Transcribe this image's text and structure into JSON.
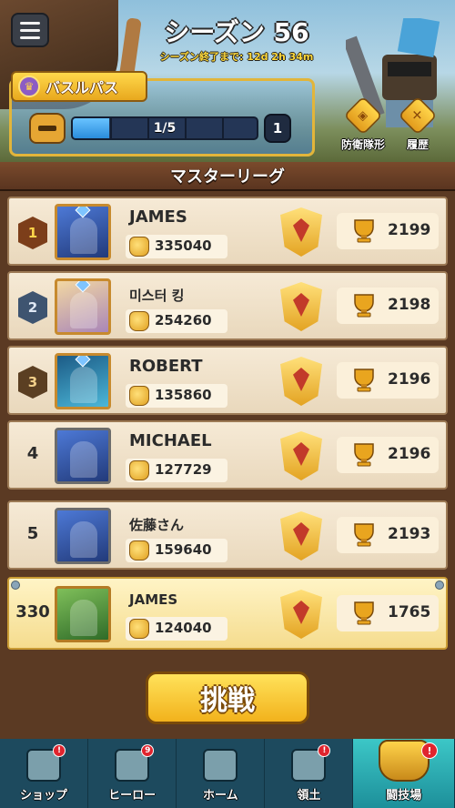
{
  "header": {
    "season_title": "シーズン 56",
    "season_remaining": "シーズン終了まで: 12d 2h 34m"
  },
  "pass": {
    "label": "バスルパス",
    "progress_text": "1/5",
    "progress_fraction": 0.2,
    "level": "1"
  },
  "side_buttons": [
    {
      "label": "防衛隊形",
      "icon": "formation-icon"
    },
    {
      "label": "履歴",
      "icon": "history-icon"
    }
  ],
  "league": {
    "title": "マスターリーグ"
  },
  "rows": [
    {
      "rank": "1",
      "name": "JAMES",
      "score": "335040",
      "trophies": "2199"
    },
    {
      "rank": "2",
      "name": "미스터 킹",
      "score": "254260",
      "trophies": "2198"
    },
    {
      "rank": "3",
      "name": "ROBERT",
      "score": "135860",
      "trophies": "2196"
    },
    {
      "rank": "4",
      "name": "MICHAEL",
      "score": "127729",
      "trophies": "2196"
    },
    {
      "rank": "5",
      "name": "佐藤さん",
      "score": "159640",
      "trophies": "2193"
    },
    {
      "rank": "330",
      "name": "JAMES",
      "score": "124040",
      "trophies": "1765"
    }
  ],
  "challenge": {
    "label": "挑戦"
  },
  "nav": [
    {
      "label": "ショップ",
      "badge": "!"
    },
    {
      "label": "ヒーロー",
      "badge": "9"
    },
    {
      "label": "ホーム",
      "badge": ""
    },
    {
      "label": "領土",
      "badge": "!"
    },
    {
      "label": "闘技場",
      "badge": "!"
    }
  ],
  "colors": {
    "accent_gold": "#f2b21c",
    "nav_bg": "#1d4a5e",
    "nav_active": "#3cc7c7",
    "row_bg": "#f6ead6",
    "row_me_bg": "#fff4c6"
  }
}
